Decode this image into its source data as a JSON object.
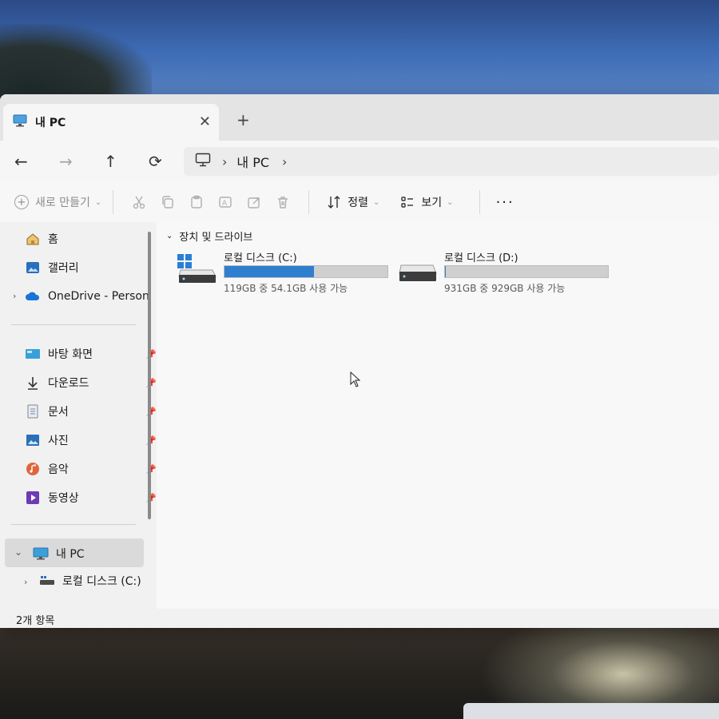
{
  "window": {
    "tab_title": "내 PC",
    "tab_close": "✕",
    "new_tab": "+"
  },
  "nav": {
    "back": "←",
    "forward": "→",
    "up": "↑",
    "refresh": "⟳",
    "address_separator": "›",
    "address_location": "내 PC"
  },
  "toolbar": {
    "new_label": "새로 만들기",
    "sort_label": "정렬",
    "view_label": "보기",
    "more_label": "···",
    "icons": [
      "cut-icon",
      "copy-icon",
      "paste-icon",
      "rename-icon",
      "share-icon",
      "delete-icon"
    ]
  },
  "sidebar": {
    "items": [
      {
        "label": "홈",
        "icon": "home-icon"
      },
      {
        "label": "갤러리",
        "icon": "gallery-icon"
      },
      {
        "label": "OneDrive - Person",
        "icon": "onedrive-icon"
      },
      {
        "label": "바탕 화면",
        "icon": "desktop-icon"
      },
      {
        "label": "다운로드",
        "icon": "download-icon"
      },
      {
        "label": "문서",
        "icon": "documents-icon"
      },
      {
        "label": "사진",
        "icon": "pictures-icon"
      },
      {
        "label": "음악",
        "icon": "music-icon"
      },
      {
        "label": "동영상",
        "icon": "videos-icon"
      },
      {
        "label": "내 PC",
        "icon": "pc-icon"
      },
      {
        "label": "로컬 디스크 (C:)",
        "icon": "drive-icon"
      }
    ]
  },
  "content": {
    "section_title": "장치 및 드라이브",
    "drives": [
      {
        "name": "로컬 디스크 (C:)",
        "info": "119GB 중 54.1GB 사용 가능",
        "used_fraction": 0.55
      },
      {
        "name": "로컬 디스크 (D:)",
        "info": "931GB 중 929GB 사용 가능",
        "used_fraction": 0.002
      }
    ]
  },
  "status": {
    "item_count": "2개 항목"
  },
  "colors": {
    "accent": "#2f7fd0"
  }
}
